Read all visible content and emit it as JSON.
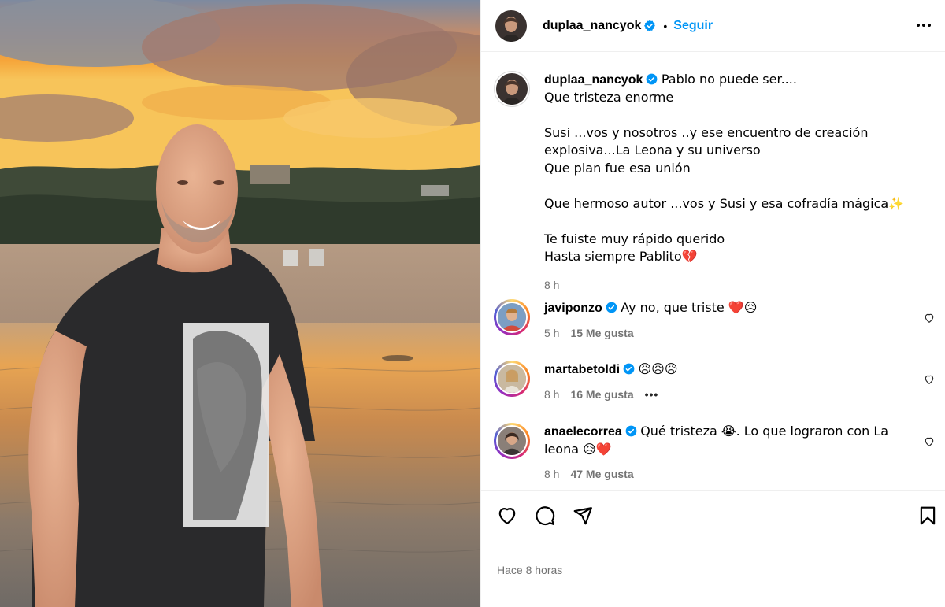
{
  "post": {
    "author": "duplaa_nancyok",
    "follow_label": "Seguir",
    "separator": "•",
    "caption": "Pablo no puede ser....\nQue tristeza enorme\n\nSusi ...vos y nosotros ..y ese encuentro de creación explosiva...La Leona y su universo\nQue plan fue esa unión\n\nQue hermoso autor ...vos y Susi y esa cofradía mágica✨\n\nTe fuiste muy rápido querido\nHasta siempre Pablito💔",
    "caption_time": "8 h",
    "timestamp": "Hace 8 horas"
  },
  "comments": [
    {
      "username": "javiponzo",
      "text": "Ay no, que triste ❤️😥",
      "time": "5 h",
      "likes": "15 Me gusta"
    },
    {
      "username": "martabetoldi",
      "text": "😥😥😥",
      "time": "8 h",
      "likes": "16 Me gusta",
      "more": "•••"
    },
    {
      "username": "anaelecorrea",
      "text": "Qué tristeza 😭. Lo que lograron con La leona 😥❤️",
      "time": "8 h",
      "likes": "47 Me gusta"
    }
  ],
  "icons": {
    "verified": "verified-badge-icon",
    "more": "more-options-icon",
    "like": "heart-icon",
    "comment": "comment-icon",
    "share": "share-icon",
    "save": "bookmark-icon"
  },
  "colors": {
    "accent": "#0095f6",
    "muted": "#737373",
    "divider": "#efefef",
    "verified": "#0095f6"
  }
}
